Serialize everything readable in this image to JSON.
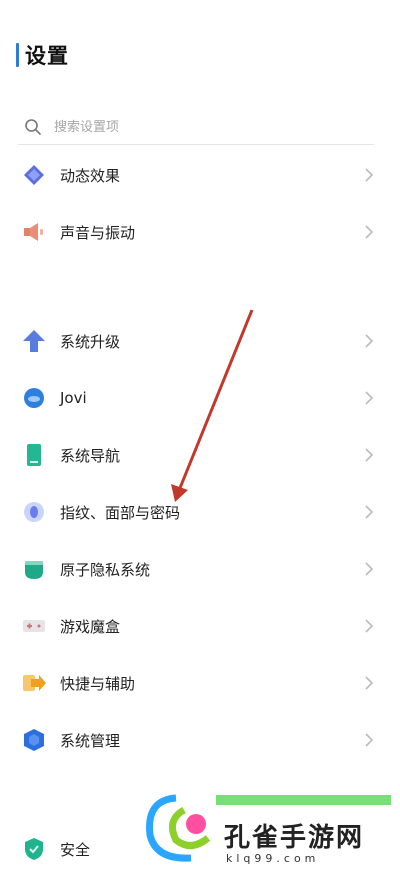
{
  "header": {
    "title": "设置"
  },
  "search": {
    "placeholder": "搜索设置项"
  },
  "items": [
    {
      "label": "动态效果",
      "icon": "dynamic-effect-icon"
    },
    {
      "label": "声音与振动",
      "icon": "speaker-icon"
    },
    {
      "label": "系统升级",
      "icon": "upgrade-arrow-icon"
    },
    {
      "label": "Jovi",
      "icon": "jovi-icon"
    },
    {
      "label": "系统导航",
      "icon": "navigation-phone-icon"
    },
    {
      "label": "指纹、面部与密码",
      "icon": "fingerprint-icon"
    },
    {
      "label": "原子隐私系统",
      "icon": "privacy-icon"
    },
    {
      "label": "游戏魔盒",
      "icon": "game-box-icon"
    },
    {
      "label": "快捷与辅助",
      "icon": "shortcut-icon"
    },
    {
      "label": "系统管理",
      "icon": "system-management-icon"
    },
    {
      "label": "安全",
      "icon": "security-shield-icon"
    }
  ],
  "watermark": {
    "brand": "孔雀手游网",
    "domain": "klq99.com"
  },
  "colors": {
    "accent": "#2f7bd6",
    "arrow": "#c0392b"
  }
}
